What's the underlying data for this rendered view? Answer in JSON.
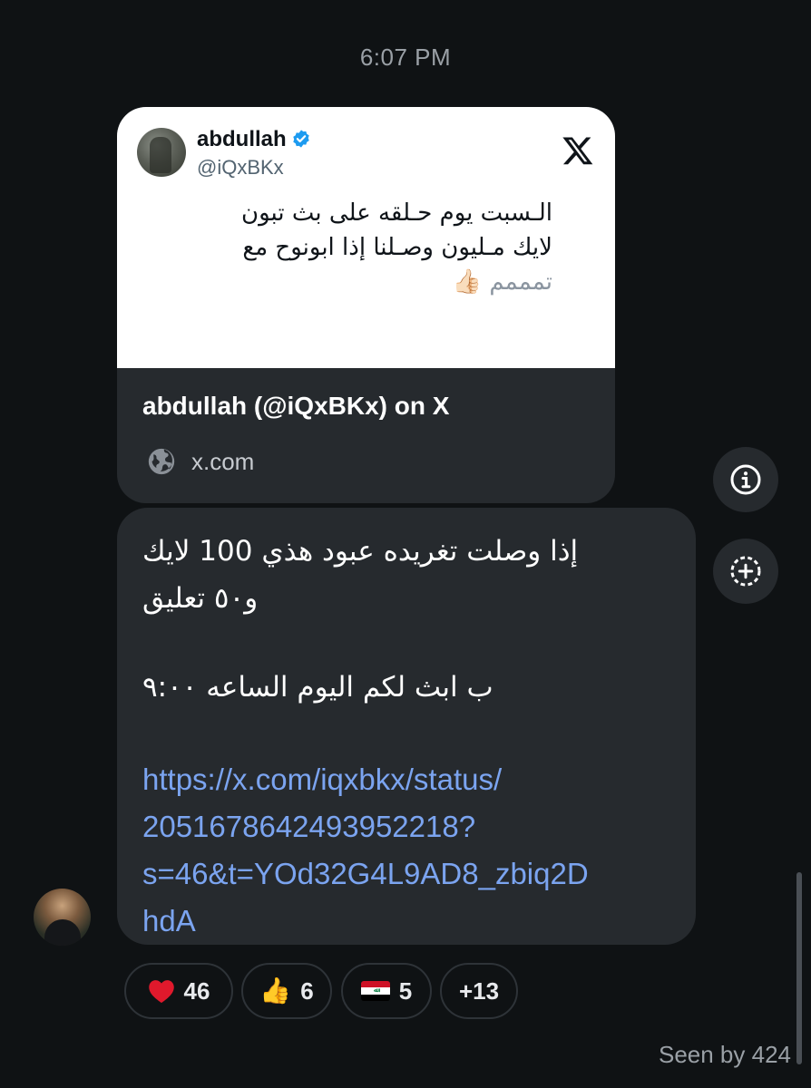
{
  "timestamp": "6:07 PM",
  "link_card": {
    "tweet": {
      "name": "abdullah",
      "handle": "@iQxBKx",
      "verified": true,
      "line1": "الـسبت  يوم  حـلقه  على  بث    تبون",
      "line2": "لايك  مـليون    وصـلنا إذا    ابونوح مع",
      "line3_text": "تمممم",
      "line3_emoji": "👍🏻"
    },
    "title": "abdullah (@iQxBKx) on X",
    "domain": "x.com",
    "icons": {
      "brand": "x-logo-icon",
      "globe": "globe-icon"
    }
  },
  "message": {
    "line1": "إذا وصلت تغريده عبود هذي 100 لايك",
    "line2": "و٥٠ تعليق",
    "line3": "ب ابث لكم اليوم الساعه ٩:٠٠",
    "link_lines": [
      "https://x.com/iqxbkx/status/",
      "2051678642493952218?",
      "s=46&t=YOd32G4L9AD8_zbiq2D",
      "hdA"
    ]
  },
  "side_actions": {
    "info_icon": "info-icon",
    "add_reaction_icon": "add-reaction-icon"
  },
  "reactions": [
    {
      "emoji": "heart",
      "count": "46"
    },
    {
      "emoji": "👍",
      "count": "6"
    },
    {
      "emoji": "iraq-flag",
      "count": "5"
    },
    {
      "emoji": "",
      "count": "+13"
    }
  ],
  "seen_by": "Seen by 424",
  "colors": {
    "background": "#0f1214",
    "bubble": "#262a2e",
    "link": "#7ba4f0",
    "verified": "#1d9bf0"
  }
}
